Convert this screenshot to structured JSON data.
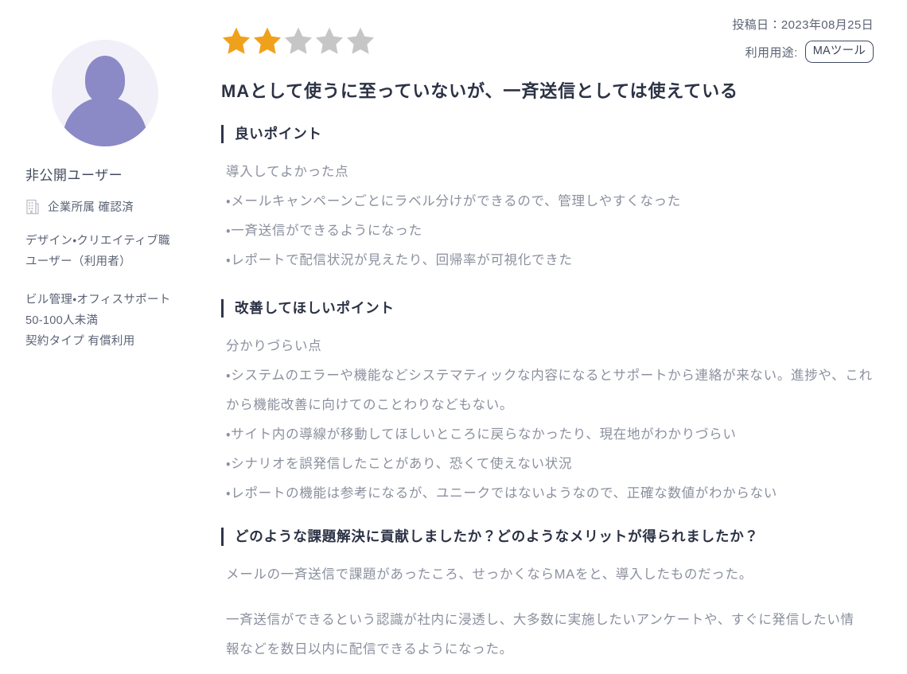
{
  "colors": {
    "star_filled": "#f0a11c",
    "star_empty": "#c6c6c6",
    "avatar_bg": "#f1f0f8",
    "avatar_fg": "#8b89c6",
    "heading": "#2c3245",
    "body_text": "#8b909e",
    "meta_text": "#5c6375",
    "accent_bar": "#2f3648",
    "badge_border": "#404a63",
    "page_bg": "#ffffff"
  },
  "profile": {
    "avatar_icon": "user-silhouette-icon",
    "name": "非公開ユーザー",
    "verified_icon": "building-icon",
    "verified_text": "企業所属 確認済",
    "occupation": "デザイン・クリエイティブ職",
    "user_role": "ユーザー（利用者）",
    "industry": "ビル管理・オフィスサポート",
    "company_size": "50-100人未満",
    "contract_type": "契約タイプ 有償利用"
  },
  "rating": {
    "value": 2,
    "max": 5,
    "star_icon": "star-icon"
  },
  "post_meta": {
    "date_label": "投稿日：2023年08月25日",
    "usage_label": "利用用途:",
    "usage_badge": "MAツール"
  },
  "review": {
    "title": "MAとして使うに至っていないが、一斉送信としては使えている",
    "sections": [
      {
        "heading": "良いポイント",
        "intro": "導入してよかった点",
        "lines": [
          "・メールキャンペーンごとにラベル分けができるので、管理しやすくなった",
          "・一斉送信ができるようになった",
          "・レポートで配信状況が見えたり、回帰率が可視化できた"
        ]
      },
      {
        "heading": "改善してほしいポイント",
        "intro": "分かりづらい点",
        "lines": [
          "・システムのエラーや機能などシステマティックな内容になるとサポートから連絡が来ない。進捗や、これから機能改善に向けてのことわりなどもない。",
          "・サイト内の導線が移動してほしいところに戻らなかったり、現在地がわかりづらい",
          "・シナリオを誤発信したことがあり、恐くて使えない状況",
          "・レポートの機能は参考になるが、ユニークではないようなので、正確な数値がわからない"
        ]
      },
      {
        "heading": "どのような課題解決に貢献しましたか？どのようなメリットが得られましたか？",
        "paragraphs": [
          "メールの一斉送信で課題があったころ、せっかくならMAをと、導入したものだった。",
          "一斉送信ができるという認識が社内に浸透し、大多数に実施したいアンケートや、すぐに発信したい情報などを数日以内に配信できるようになった。"
        ]
      }
    ]
  }
}
